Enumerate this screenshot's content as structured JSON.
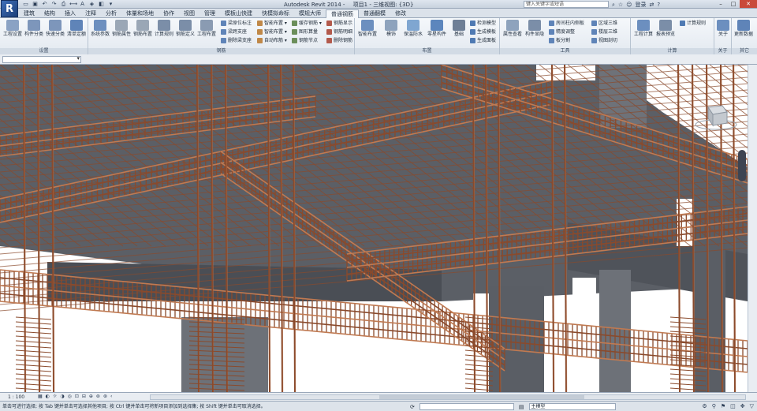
{
  "titlebar": {
    "app_title": "Autodesk Revit 2014 -",
    "project_title": "项目1 - 三维视图: {3D}",
    "search_placeholder": "键入关键字或短语",
    "login_label": "登录",
    "qat_icons": [
      "open-icon",
      "save-icon",
      "undo-icon",
      "redo-icon",
      "print-icon",
      "measure-icon",
      "text-icon",
      "3d-icon",
      "section-icon",
      "close-window-icon"
    ]
  },
  "tabs": [
    "建筑",
    "结构",
    "插入",
    "注释",
    "分析",
    "体量和场地",
    "协作",
    "视图",
    "管理",
    "模板山快建",
    "快模拟命标",
    "模规大师",
    "普通钢筋",
    "普通翻模",
    "修改"
  ],
  "active_tab": 12,
  "ribbon": {
    "panels": {
      "settings": "设置",
      "rebar": "钢筋",
      "layout": "布置",
      "tools": "工具",
      "calc": "计算",
      "about": "关于",
      "other": "其它"
    },
    "settings_buttons": [
      "工程设置",
      "构件分类",
      "快速分类",
      "清单定额"
    ],
    "rebar_big_buttons": [
      "系统参数",
      "钢筋属性",
      "钢筋布置",
      "计算规则",
      "钢筋定义",
      "工程布置"
    ],
    "rebar_small_col1": [
      "梁原位标注",
      "梁跨支座",
      "删除梁支座"
    ],
    "rebar_small_col2": [
      "智能布置 ▾",
      "智能布置 ▾",
      "自动布筋 ▾"
    ],
    "rebar_small_col3": [
      "缓存钢筋 ▾",
      "图形算量",
      "钢筋节点"
    ],
    "rebar_small_col4": [
      "钢筋显示",
      "钢筋明细",
      "删除钢筋"
    ],
    "layout_buttons": [
      "智能布置",
      "模饰",
      "保温防水",
      "零星构件",
      "基础"
    ],
    "layout_small": [
      "检测模型",
      "生成模板",
      "生成面板"
    ],
    "tools_big": [
      "属性查看",
      "构件显隐"
    ],
    "tools_small_col1": [
      "房间柱内侧板",
      "精度调整",
      "板分割"
    ],
    "tools_small_col2": [
      "区域三维",
      "楼层三维",
      "视图剖切"
    ],
    "calc_buttons": [
      "工程计算",
      "报表预览"
    ],
    "calc_small": [
      "计算规则"
    ],
    "about_button": "关于",
    "other_button": "更新数据"
  },
  "viewbar": {
    "scale": "1 : 100"
  },
  "statusbar": {
    "message": "单击可进行选择; 按 Tab 键并单击可选择其他项目; 按 Ctrl 键并单击可将新项目添加到选择集; 按 Shift 键并单击可取消选择。",
    "model_label": "主模型"
  },
  "colors": {
    "rebar": "#8a4a2c",
    "rebar_highlight": "#c07a52",
    "concrete": "#6d7178",
    "background": "#ffffff"
  }
}
